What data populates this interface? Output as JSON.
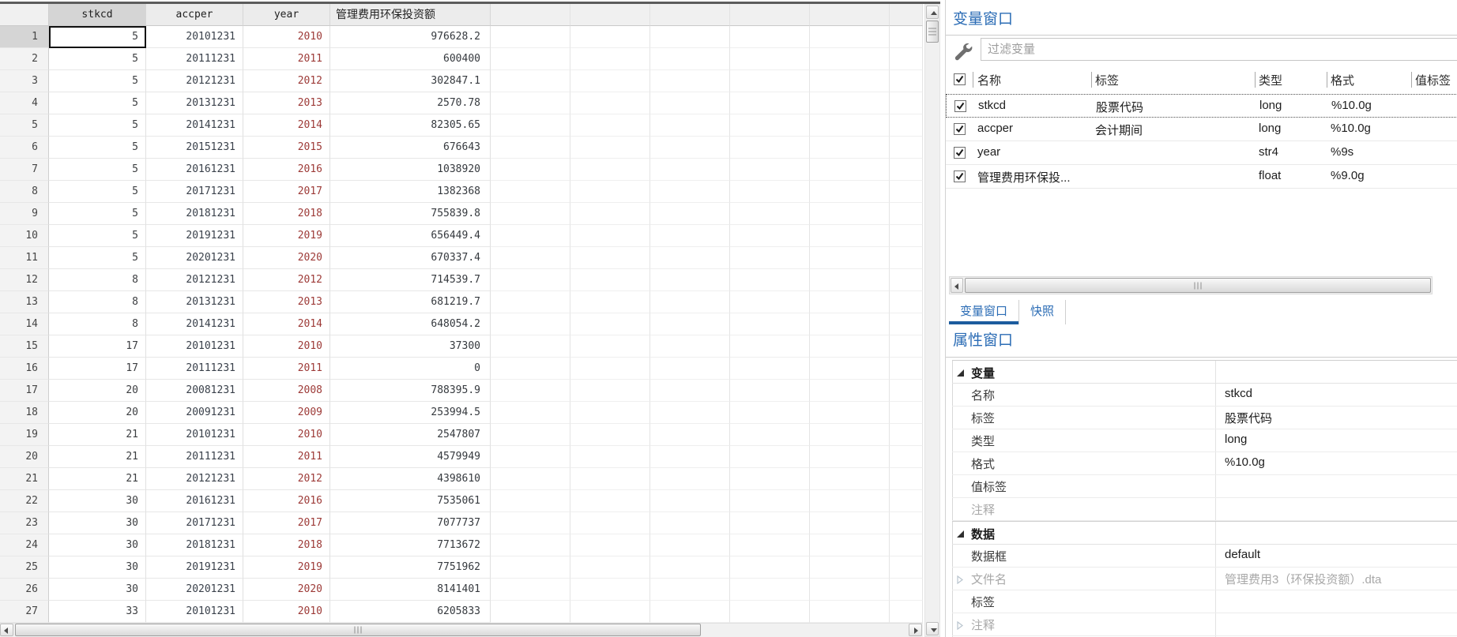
{
  "table": {
    "columns": [
      {
        "key": "stkcd",
        "label": "stkcd"
      },
      {
        "key": "accper",
        "label": "accper"
      },
      {
        "key": "year",
        "label": "year"
      },
      {
        "key": "value",
        "label": "管理费用环保投资额"
      }
    ],
    "selected_cell": {
      "row": "1",
      "column": "stkcd"
    },
    "rows": [
      {
        "n": "1",
        "stkcd": "5",
        "accper": "20101231",
        "year": "2010",
        "value": "976628.2"
      },
      {
        "n": "2",
        "stkcd": "5",
        "accper": "20111231",
        "year": "2011",
        "value": "600400"
      },
      {
        "n": "3",
        "stkcd": "5",
        "accper": "20121231",
        "year": "2012",
        "value": "302847.1"
      },
      {
        "n": "4",
        "stkcd": "5",
        "accper": "20131231",
        "year": "2013",
        "value": "2570.78"
      },
      {
        "n": "5",
        "stkcd": "5",
        "accper": "20141231",
        "year": "2014",
        "value": "82305.65"
      },
      {
        "n": "6",
        "stkcd": "5",
        "accper": "20151231",
        "year": "2015",
        "value": "676643"
      },
      {
        "n": "7",
        "stkcd": "5",
        "accper": "20161231",
        "year": "2016",
        "value": "1038920"
      },
      {
        "n": "8",
        "stkcd": "5",
        "accper": "20171231",
        "year": "2017",
        "value": "1382368"
      },
      {
        "n": "9",
        "stkcd": "5",
        "accper": "20181231",
        "year": "2018",
        "value": "755839.8"
      },
      {
        "n": "10",
        "stkcd": "5",
        "accper": "20191231",
        "year": "2019",
        "value": "656449.4"
      },
      {
        "n": "11",
        "stkcd": "5",
        "accper": "20201231",
        "year": "2020",
        "value": "670337.4"
      },
      {
        "n": "12",
        "stkcd": "8",
        "accper": "20121231",
        "year": "2012",
        "value": "714539.7"
      },
      {
        "n": "13",
        "stkcd": "8",
        "accper": "20131231",
        "year": "2013",
        "value": "681219.7"
      },
      {
        "n": "14",
        "stkcd": "8",
        "accper": "20141231",
        "year": "2014",
        "value": "648054.2"
      },
      {
        "n": "15",
        "stkcd": "17",
        "accper": "20101231",
        "year": "2010",
        "value": "37300"
      },
      {
        "n": "16",
        "stkcd": "17",
        "accper": "20111231",
        "year": "2011",
        "value": "0"
      },
      {
        "n": "17",
        "stkcd": "20",
        "accper": "20081231",
        "year": "2008",
        "value": "788395.9"
      },
      {
        "n": "18",
        "stkcd": "20",
        "accper": "20091231",
        "year": "2009",
        "value": "253994.5"
      },
      {
        "n": "19",
        "stkcd": "21",
        "accper": "20101231",
        "year": "2010",
        "value": "2547807"
      },
      {
        "n": "20",
        "stkcd": "21",
        "accper": "20111231",
        "year": "2011",
        "value": "4579949"
      },
      {
        "n": "21",
        "stkcd": "21",
        "accper": "20121231",
        "year": "2012",
        "value": "4398610"
      },
      {
        "n": "22",
        "stkcd": "30",
        "accper": "20161231",
        "year": "2016",
        "value": "7535061"
      },
      {
        "n": "23",
        "stkcd": "30",
        "accper": "20171231",
        "year": "2017",
        "value": "7077737"
      },
      {
        "n": "24",
        "stkcd": "30",
        "accper": "20181231",
        "year": "2018",
        "value": "7713672"
      },
      {
        "n": "25",
        "stkcd": "30",
        "accper": "20191231",
        "year": "2019",
        "value": "7751962"
      },
      {
        "n": "26",
        "stkcd": "30",
        "accper": "20201231",
        "year": "2020",
        "value": "8141401"
      },
      {
        "n": "27",
        "stkcd": "33",
        "accper": "20101231",
        "year": "2010",
        "value": "6205833"
      }
    ]
  },
  "variables_window": {
    "title": "变量窗口",
    "filter_placeholder": "过滤变量",
    "columns": [
      "名称",
      "标签",
      "类型",
      "格式",
      "值标签"
    ],
    "variables": [
      {
        "checked": true,
        "name": "stkcd",
        "label": "股票代码",
        "type": "long",
        "format": "%10.0g",
        "selected": true
      },
      {
        "checked": true,
        "name": "accper",
        "label": "会计期间",
        "type": "long",
        "format": "%10.0g",
        "selected": false
      },
      {
        "checked": true,
        "name": "year",
        "label": "",
        "type": "str4",
        "format": "%9s",
        "selected": false
      },
      {
        "checked": true,
        "name": "管理费用环保投...",
        "label": "",
        "type": "float",
        "format": "%9.0g",
        "selected": false
      }
    ],
    "tabs": [
      {
        "label": "变量窗口",
        "active": true
      },
      {
        "label": "快照",
        "active": false
      }
    ]
  },
  "properties_window": {
    "title": "属性窗口",
    "sections": [
      {
        "label": "变量",
        "rows": [
          {
            "label": "名称",
            "value": "stkcd",
            "muted": false,
            "expander": false
          },
          {
            "label": "标签",
            "value": "股票代码",
            "muted": false,
            "expander": false
          },
          {
            "label": "类型",
            "value": "long",
            "muted": false,
            "expander": false
          },
          {
            "label": "格式",
            "value": "%10.0g",
            "muted": false,
            "expander": false
          },
          {
            "label": "值标签",
            "value": "",
            "muted": false,
            "expander": false
          },
          {
            "label": "注释",
            "value": "",
            "muted": true,
            "expander": false
          }
        ]
      },
      {
        "label": "数据",
        "rows": [
          {
            "label": "数据框",
            "value": "default",
            "muted": false,
            "expander": false
          },
          {
            "label": "文件名",
            "value": "管理费用3（环保投资额）.dta",
            "muted": true,
            "expander": true
          },
          {
            "label": "标签",
            "value": "",
            "muted": false,
            "expander": false
          },
          {
            "label": "注释",
            "value": "",
            "muted": true,
            "expander": true
          }
        ]
      }
    ]
  },
  "colors": {
    "accent_blue": "#2b6cb5",
    "tab_underline": "#1c5c9e",
    "string_red": "#9d3a37",
    "numeric_dark": "#39404a"
  }
}
